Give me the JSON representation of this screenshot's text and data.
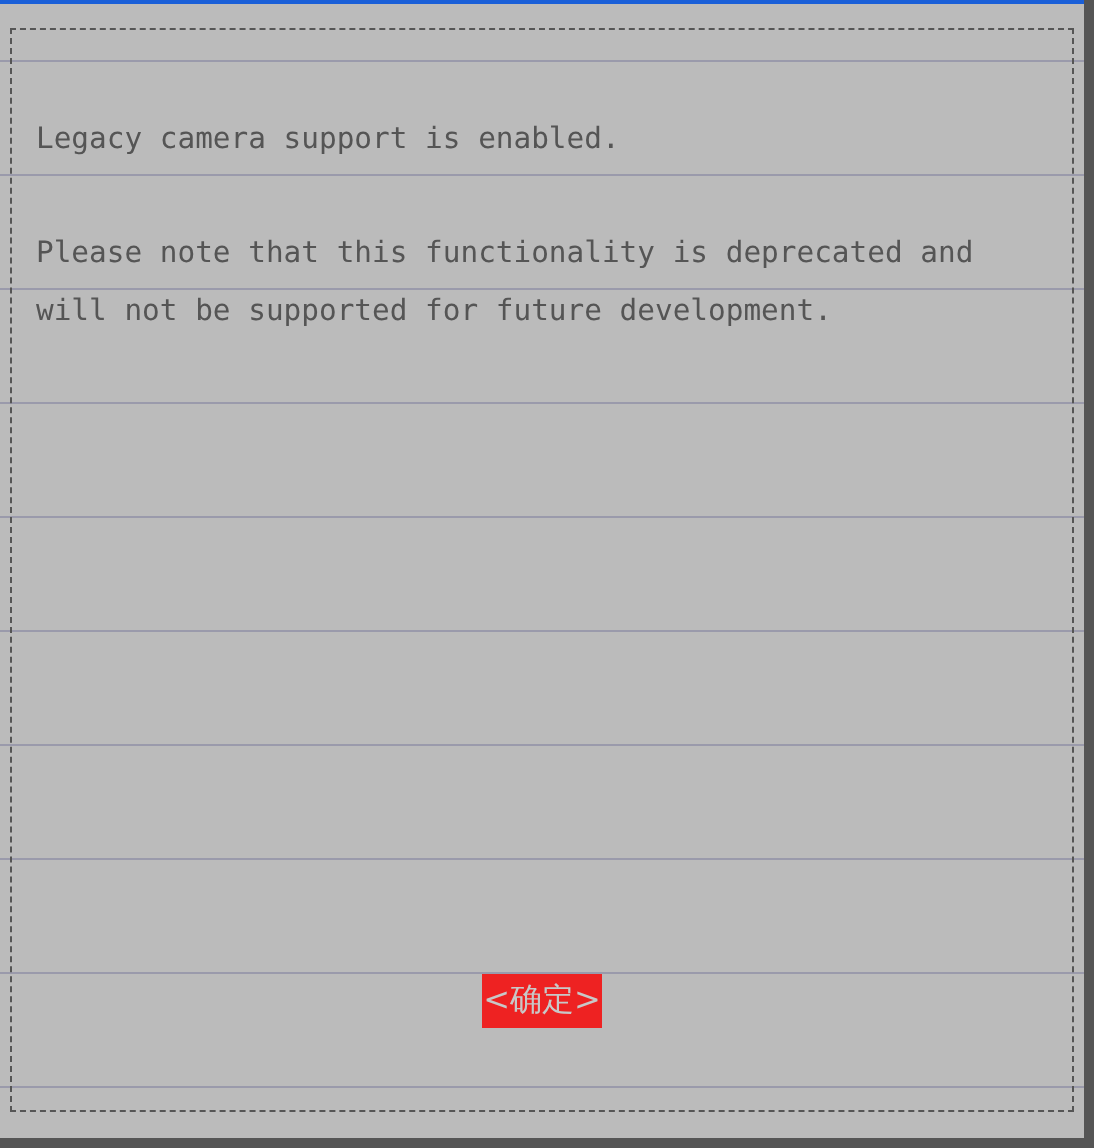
{
  "dialog": {
    "paragraphs": [
      "Legacy camera support is enabled.",
      "Please note that this functionality is deprecated and will not be supported for future development."
    ],
    "button": {
      "label": "<确定>",
      "selected": true
    }
  }
}
